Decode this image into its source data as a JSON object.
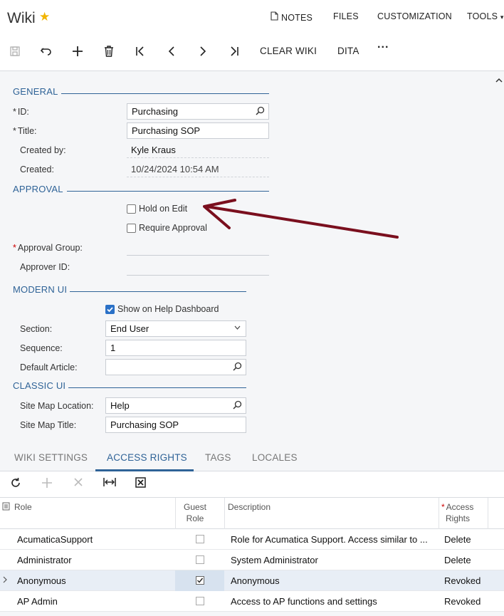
{
  "header": {
    "title": "Wiki",
    "links": [
      "NOTES",
      "FILES",
      "CUSTOMIZATION",
      "TOOLS"
    ],
    "toolbar": {
      "clear_wiki": "CLEAR WIKI",
      "dita": "DITA",
      "more": "···"
    }
  },
  "general": {
    "section": "GENERAL",
    "id_label": "ID:",
    "id_value": "Purchasing",
    "title_label": "Title:",
    "title_value": "Purchasing SOP",
    "created_by_label": "Created by:",
    "created_by_value": "Kyle Kraus",
    "created_label": "Created:",
    "created_value": "10/24/2024 10:54 AM",
    "required_mark": "*"
  },
  "approval": {
    "section": "APPROVAL",
    "hold_on_edit": "Hold on Edit",
    "require_approval": "Require Approval",
    "approval_group_label": "Approval Group:",
    "approver_id_label": "Approver ID:"
  },
  "modern_ui": {
    "section": "MODERN UI",
    "show_on_help": "Show on Help Dashboard",
    "section_label": "Section:",
    "section_value": "End User",
    "sequence_label": "Sequence:",
    "sequence_value": "1",
    "default_article_label": "Default Article:",
    "default_article_value": ""
  },
  "classic_ui": {
    "section": "CLASSIC UI",
    "site_map_location_label": "Site Map Location:",
    "site_map_location_value": "Help",
    "site_map_title_label": "Site Map Title:",
    "site_map_title_value": "Purchasing SOP"
  },
  "tabs": [
    "WIKI SETTINGS",
    "ACCESS RIGHTS",
    "TAGS",
    "LOCALES"
  ],
  "grid": {
    "headers": {
      "role": "Role",
      "guest_role_1": "Guest",
      "guest_role_2": "Role",
      "description": "Description",
      "access_1": "Access",
      "access_2": "Rights"
    },
    "rows": [
      {
        "role": "AcumaticaSupport",
        "guest": false,
        "description": "Role for Acumatica Support. Access similar to ...",
        "access": "Delete"
      },
      {
        "role": "Administrator",
        "guest": false,
        "description": "System Administrator",
        "access": "Delete"
      },
      {
        "role": "Anonymous",
        "guest": true,
        "description": "Anonymous",
        "access": "Revoked"
      },
      {
        "role": "AP Admin",
        "guest": false,
        "description": "Access to AP functions and settings",
        "access": "Revoked"
      }
    ]
  },
  "colors": {
    "accent": "#2f6397",
    "annotation_arrow": "#7a0f1e",
    "star": "#f1b400",
    "checkbox_on": "#2b71c7"
  }
}
